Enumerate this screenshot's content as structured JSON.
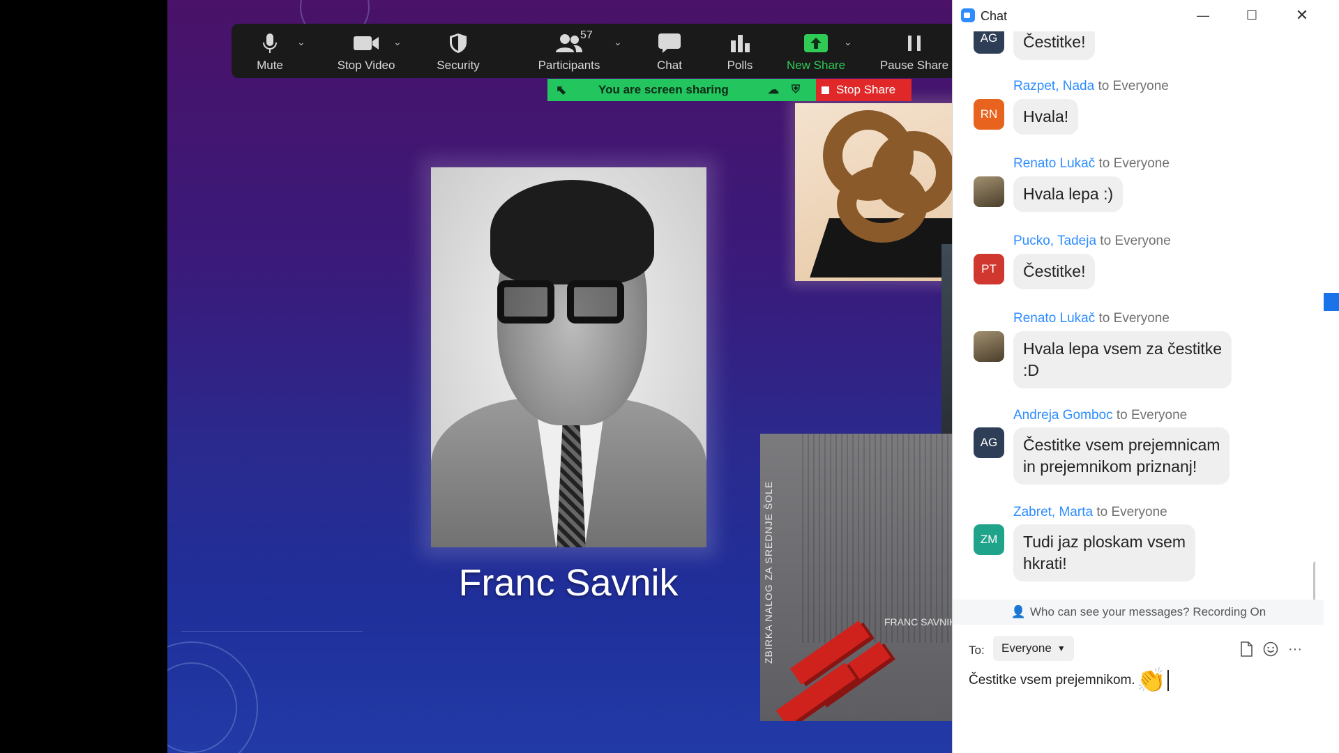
{
  "toolbar": {
    "mute": "Mute",
    "stop_video": "Stop Video",
    "security": "Security",
    "participants": "Participants",
    "participants_count": "57",
    "chat": "Chat",
    "polls": "Polls",
    "new_share": "New Share",
    "pause_share": "Pause Share"
  },
  "share_banner": {
    "text": "You are screen sharing",
    "stop": "Stop Share"
  },
  "slide": {
    "name": "Franc Savnik",
    "book_vertical": "ZBIRKA NALOG ZA SREDNJE ŠOLE",
    "book_author": "FRANC SAVNIK"
  },
  "chat": {
    "title": "Chat",
    "messages": [
      {
        "initials": "AG",
        "sender": "",
        "to": "",
        "text": "Čestitke!",
        "avatar_color": "#2f3e57"
      },
      {
        "initials": "RN",
        "sender": "Razpet, Nada",
        "to": "to Everyone",
        "text": "Hvala!",
        "avatar_color": "#e8641e"
      },
      {
        "initials": "",
        "sender": "Renato Lukač",
        "to": "to Everyone",
        "text": "Hvala lepa :)",
        "avatar_color": "#7a6c4e"
      },
      {
        "initials": "PT",
        "sender": "Pucko, Tadeja",
        "to": "to Everyone",
        "text": "Čestitke!",
        "avatar_color": "#d0382f"
      },
      {
        "initials": "",
        "sender": "Renato Lukač",
        "to": "to Everyone",
        "text_line1": "Hvala lepa vsem za čestitke",
        "text_line2": ":D",
        "avatar_color": "#7a6c4e"
      },
      {
        "initials": "AG",
        "sender": "Andreja Gomboc",
        "to": "to Everyone",
        "text_line1": "Čestitke vsem prejemnicam",
        "text_line2": "in prejemnikom priznanj!",
        "avatar_color": "#2f3e57"
      },
      {
        "initials": "ZM",
        "sender": "Zabret, Marta",
        "to": "to Everyone",
        "text_line1": "Tudi jaz ploskam vsem",
        "text_line2": "hkrati!",
        "avatar_color": "#1fa38a"
      }
    ],
    "privacy_notice": "Who can see your messages? Recording On",
    "to_label": "To:",
    "to_value": "Everyone",
    "draft": "Čestitke vsem prejemnikom."
  },
  "icons": [
    "microphone-icon",
    "video-camera-icon",
    "shield-icon",
    "participants-icon",
    "chat-bubble-icon",
    "polls-icon",
    "share-arrow-icon",
    "pause-icon",
    "file-icon",
    "emoji-icon",
    "more-icon"
  ],
  "colors": {
    "accent": "#2d8cff",
    "share_green": "#22c55e",
    "stop_red": "#e02828"
  }
}
